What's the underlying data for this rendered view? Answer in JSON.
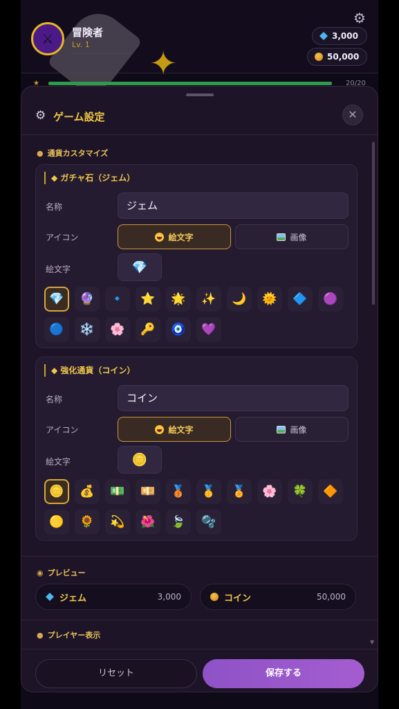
{
  "player": {
    "name": "冒険者",
    "level": "Lv. 1",
    "hp": "20/20"
  },
  "currency_top": {
    "gems": "3,000",
    "coins": "50,000"
  },
  "modal": {
    "title": "ゲーム設定",
    "close_label": "✕",
    "currency_section": {
      "label": "通貨カスタマイズ",
      "gacha": {
        "title": "ガチャ石（ジェム）",
        "name_label": "名称",
        "name_value": "ジェム",
        "icon_label": "アイコン",
        "emoji_toggle": "絵文字",
        "image_toggle": "画像",
        "emoji_label": "絵文字",
        "selected": "💎",
        "options": [
          "💎",
          "🔮",
          "🔹",
          "⭐",
          "🌟",
          "✨",
          "🌙",
          "🌞",
          "🔷",
          "🟣",
          "🔵",
          "❄️",
          "🌸",
          "🔑",
          "🧿",
          "💜"
        ]
      },
      "coin": {
        "title": "強化通貨（コイン）",
        "name_label": "名称",
        "name_value": "コイン",
        "icon_label": "アイコン",
        "emoji_toggle": "絵文字",
        "image_toggle": "画像",
        "emoji_label": "絵文字",
        "selected": "🪙",
        "options": [
          "🪙",
          "💰",
          "💵",
          "💴",
          "🥉",
          "🥇",
          "🏅",
          "🌸",
          "🍀",
          "🔶",
          "🟡",
          "🌻",
          "💫",
          "🌺",
          "🍃",
          "🫧"
        ]
      }
    },
    "preview": {
      "label": "プレビュー",
      "gem_name": "ジェム",
      "gem_value": "3,000",
      "coin_name": "コイン",
      "coin_value": "50,000"
    },
    "player_display": {
      "label": "プレイヤー表示"
    },
    "footer": {
      "reset": "リセット",
      "save": "保存する"
    }
  },
  "colors": {
    "accent_gold": "#f0c742",
    "save_purple": "#9a58cc",
    "modal_bg": "#1e1428"
  }
}
